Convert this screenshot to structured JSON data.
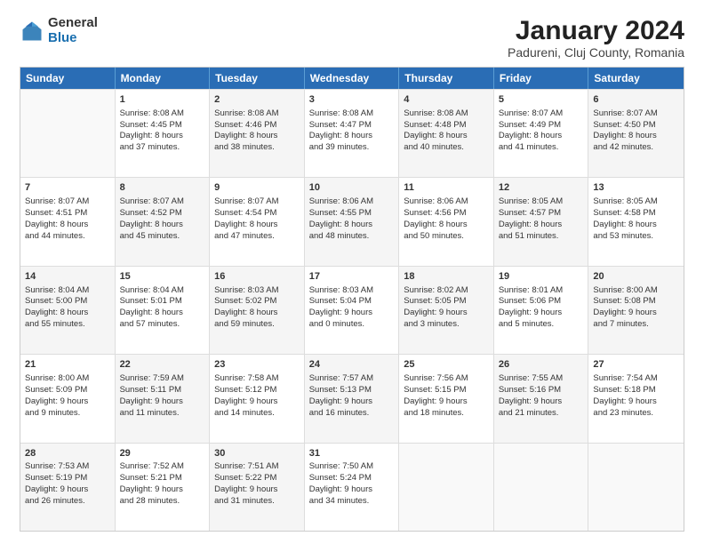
{
  "logo": {
    "general": "General",
    "blue": "Blue"
  },
  "title": "January 2024",
  "subtitle": "Padureni, Cluj County, Romania",
  "header_days": [
    "Sunday",
    "Monday",
    "Tuesday",
    "Wednesday",
    "Thursday",
    "Friday",
    "Saturday"
  ],
  "rows": [
    [
      {
        "day": "",
        "lines": [],
        "empty": true
      },
      {
        "day": "1",
        "lines": [
          "Sunrise: 8:08 AM",
          "Sunset: 4:45 PM",
          "Daylight: 8 hours",
          "and 37 minutes."
        ],
        "shaded": false
      },
      {
        "day": "2",
        "lines": [
          "Sunrise: 8:08 AM",
          "Sunset: 4:46 PM",
          "Daylight: 8 hours",
          "and 38 minutes."
        ],
        "shaded": true
      },
      {
        "day": "3",
        "lines": [
          "Sunrise: 8:08 AM",
          "Sunset: 4:47 PM",
          "Daylight: 8 hours",
          "and 39 minutes."
        ],
        "shaded": false
      },
      {
        "day": "4",
        "lines": [
          "Sunrise: 8:08 AM",
          "Sunset: 4:48 PM",
          "Daylight: 8 hours",
          "and 40 minutes."
        ],
        "shaded": true
      },
      {
        "day": "5",
        "lines": [
          "Sunrise: 8:07 AM",
          "Sunset: 4:49 PM",
          "Daylight: 8 hours",
          "and 41 minutes."
        ],
        "shaded": false
      },
      {
        "day": "6",
        "lines": [
          "Sunrise: 8:07 AM",
          "Sunset: 4:50 PM",
          "Daylight: 8 hours",
          "and 42 minutes."
        ],
        "shaded": true
      }
    ],
    [
      {
        "day": "7",
        "lines": [
          "Sunrise: 8:07 AM",
          "Sunset: 4:51 PM",
          "Daylight: 8 hours",
          "and 44 minutes."
        ],
        "shaded": false
      },
      {
        "day": "8",
        "lines": [
          "Sunrise: 8:07 AM",
          "Sunset: 4:52 PM",
          "Daylight: 8 hours",
          "and 45 minutes."
        ],
        "shaded": true
      },
      {
        "day": "9",
        "lines": [
          "Sunrise: 8:07 AM",
          "Sunset: 4:54 PM",
          "Daylight: 8 hours",
          "and 47 minutes."
        ],
        "shaded": false
      },
      {
        "day": "10",
        "lines": [
          "Sunrise: 8:06 AM",
          "Sunset: 4:55 PM",
          "Daylight: 8 hours",
          "and 48 minutes."
        ],
        "shaded": true
      },
      {
        "day": "11",
        "lines": [
          "Sunrise: 8:06 AM",
          "Sunset: 4:56 PM",
          "Daylight: 8 hours",
          "and 50 minutes."
        ],
        "shaded": false
      },
      {
        "day": "12",
        "lines": [
          "Sunrise: 8:05 AM",
          "Sunset: 4:57 PM",
          "Daylight: 8 hours",
          "and 51 minutes."
        ],
        "shaded": true
      },
      {
        "day": "13",
        "lines": [
          "Sunrise: 8:05 AM",
          "Sunset: 4:58 PM",
          "Daylight: 8 hours",
          "and 53 minutes."
        ],
        "shaded": false
      }
    ],
    [
      {
        "day": "14",
        "lines": [
          "Sunrise: 8:04 AM",
          "Sunset: 5:00 PM",
          "Daylight: 8 hours",
          "and 55 minutes."
        ],
        "shaded": true
      },
      {
        "day": "15",
        "lines": [
          "Sunrise: 8:04 AM",
          "Sunset: 5:01 PM",
          "Daylight: 8 hours",
          "and 57 minutes."
        ],
        "shaded": false
      },
      {
        "day": "16",
        "lines": [
          "Sunrise: 8:03 AM",
          "Sunset: 5:02 PM",
          "Daylight: 8 hours",
          "and 59 minutes."
        ],
        "shaded": true
      },
      {
        "day": "17",
        "lines": [
          "Sunrise: 8:03 AM",
          "Sunset: 5:04 PM",
          "Daylight: 9 hours",
          "and 0 minutes."
        ],
        "shaded": false
      },
      {
        "day": "18",
        "lines": [
          "Sunrise: 8:02 AM",
          "Sunset: 5:05 PM",
          "Daylight: 9 hours",
          "and 3 minutes."
        ],
        "shaded": true
      },
      {
        "day": "19",
        "lines": [
          "Sunrise: 8:01 AM",
          "Sunset: 5:06 PM",
          "Daylight: 9 hours",
          "and 5 minutes."
        ],
        "shaded": false
      },
      {
        "day": "20",
        "lines": [
          "Sunrise: 8:00 AM",
          "Sunset: 5:08 PM",
          "Daylight: 9 hours",
          "and 7 minutes."
        ],
        "shaded": true
      }
    ],
    [
      {
        "day": "21",
        "lines": [
          "Sunrise: 8:00 AM",
          "Sunset: 5:09 PM",
          "Daylight: 9 hours",
          "and 9 minutes."
        ],
        "shaded": false
      },
      {
        "day": "22",
        "lines": [
          "Sunrise: 7:59 AM",
          "Sunset: 5:11 PM",
          "Daylight: 9 hours",
          "and 11 minutes."
        ],
        "shaded": true
      },
      {
        "day": "23",
        "lines": [
          "Sunrise: 7:58 AM",
          "Sunset: 5:12 PM",
          "Daylight: 9 hours",
          "and 14 minutes."
        ],
        "shaded": false
      },
      {
        "day": "24",
        "lines": [
          "Sunrise: 7:57 AM",
          "Sunset: 5:13 PM",
          "Daylight: 9 hours",
          "and 16 minutes."
        ],
        "shaded": true
      },
      {
        "day": "25",
        "lines": [
          "Sunrise: 7:56 AM",
          "Sunset: 5:15 PM",
          "Daylight: 9 hours",
          "and 18 minutes."
        ],
        "shaded": false
      },
      {
        "day": "26",
        "lines": [
          "Sunrise: 7:55 AM",
          "Sunset: 5:16 PM",
          "Daylight: 9 hours",
          "and 21 minutes."
        ],
        "shaded": true
      },
      {
        "day": "27",
        "lines": [
          "Sunrise: 7:54 AM",
          "Sunset: 5:18 PM",
          "Daylight: 9 hours",
          "and 23 minutes."
        ],
        "shaded": false
      }
    ],
    [
      {
        "day": "28",
        "lines": [
          "Sunrise: 7:53 AM",
          "Sunset: 5:19 PM",
          "Daylight: 9 hours",
          "and 26 minutes."
        ],
        "shaded": true
      },
      {
        "day": "29",
        "lines": [
          "Sunrise: 7:52 AM",
          "Sunset: 5:21 PM",
          "Daylight: 9 hours",
          "and 28 minutes."
        ],
        "shaded": false
      },
      {
        "day": "30",
        "lines": [
          "Sunrise: 7:51 AM",
          "Sunset: 5:22 PM",
          "Daylight: 9 hours",
          "and 31 minutes."
        ],
        "shaded": true
      },
      {
        "day": "31",
        "lines": [
          "Sunrise: 7:50 AM",
          "Sunset: 5:24 PM",
          "Daylight: 9 hours",
          "and 34 minutes."
        ],
        "shaded": false
      },
      {
        "day": "",
        "lines": [],
        "empty": true
      },
      {
        "day": "",
        "lines": [],
        "empty": true
      },
      {
        "day": "",
        "lines": [],
        "empty": true
      }
    ]
  ]
}
